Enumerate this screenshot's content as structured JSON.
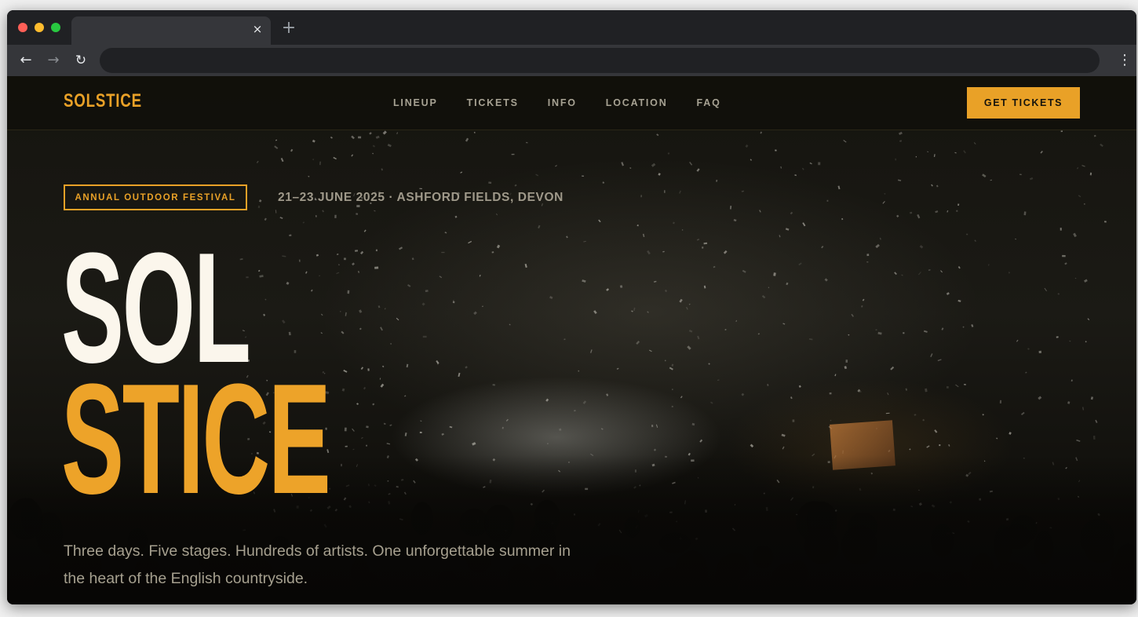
{
  "browser": {
    "tab_close_glyph": "×",
    "new_tab_glyph": "+",
    "back_glyph": "←",
    "forward_glyph": "→",
    "reload_glyph": "↻",
    "menu_glyph": "⋮"
  },
  "site": {
    "logo": "SOLSTICE",
    "nav": [
      "LINEUP",
      "TICKETS",
      "INFO",
      "LOCATION",
      "FAQ"
    ],
    "cta": "GET TICKETS"
  },
  "hero": {
    "badge": "ANNUAL OUTDOOR FESTIVAL",
    "date": "21–23 JUNE 2025 · ASHFORD FIELDS, DEVON",
    "title_line1": "SOL",
    "title_line2": "STICE",
    "tagline": "Three days. Five stages. Hundreds of artists. One unforgettable summer in the heart of the English countryside."
  },
  "colors": {
    "accent": "#e9a127",
    "header_bg": "#11100b",
    "hero_text_light": "#fbf6ec",
    "muted_text": "#a6a08f"
  }
}
